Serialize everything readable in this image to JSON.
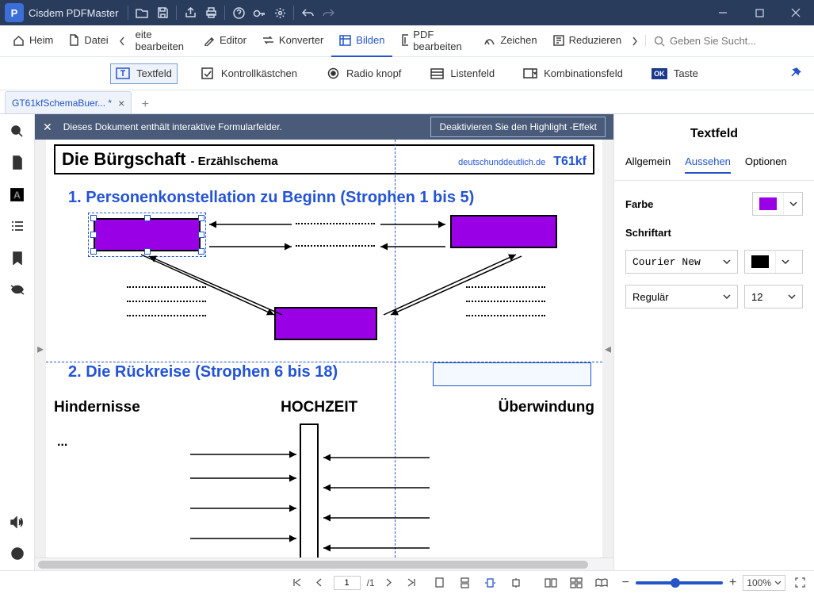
{
  "app": {
    "title": "Cisdem PDFMaster"
  },
  "mainTabs": {
    "heim": "Heim",
    "datei": "Datei",
    "seite": "eite bearbeiten",
    "editor": "Editor",
    "konverter": "Konverter",
    "bilden": "Bilden",
    "pdf": "PDF bearbeiten",
    "zeichen": "Zeichen",
    "red": "Reduzieren"
  },
  "search": {
    "placeholder": "Geben Sie Sucht..."
  },
  "formTools": {
    "textfeld": "Textfeld",
    "kontroll": "Kontrollkästchen",
    "radio": "Radio knopf",
    "listen": "Listenfeld",
    "kombi": "Kombinationsfeld",
    "taste": "Taste"
  },
  "docTab": {
    "name": "GT61kfSchemaBuer... *"
  },
  "banner": {
    "msg": "Dieses Dokument enthält interaktive Formularfelder.",
    "btn": "Deaktivieren Sie den Highlight -Effekt"
  },
  "page": {
    "title": "Die Bürgschaft",
    "sub": "- Erzählschema",
    "site": "deutschunddeutlich.de",
    "code": "T61kf",
    "sect1": "1. Personenkonstellation zu Beginn (Strophen 1 bis 5)",
    "sect2": "2. Die Rückreise (Strophen 6 bis 18)",
    "h3a": "Hindernisse",
    "h3b": "HOCHZEIT",
    "h3c": "Überwindung",
    "ellipsis": "..."
  },
  "rightPanel": {
    "title": "Textfeld",
    "tabs": {
      "allgemein": "Allgemein",
      "aussehen": "Aussehen",
      "optionen": "Optionen"
    },
    "farbe": "Farbe",
    "schriftart": "Schriftart",
    "font": "Courier New",
    "style": "Regulär",
    "size": "12",
    "colorHex": "#9a00e6",
    "fontColorHex": "#000000"
  },
  "status": {
    "page": "1",
    "total": "/1",
    "zoom": "100%"
  }
}
